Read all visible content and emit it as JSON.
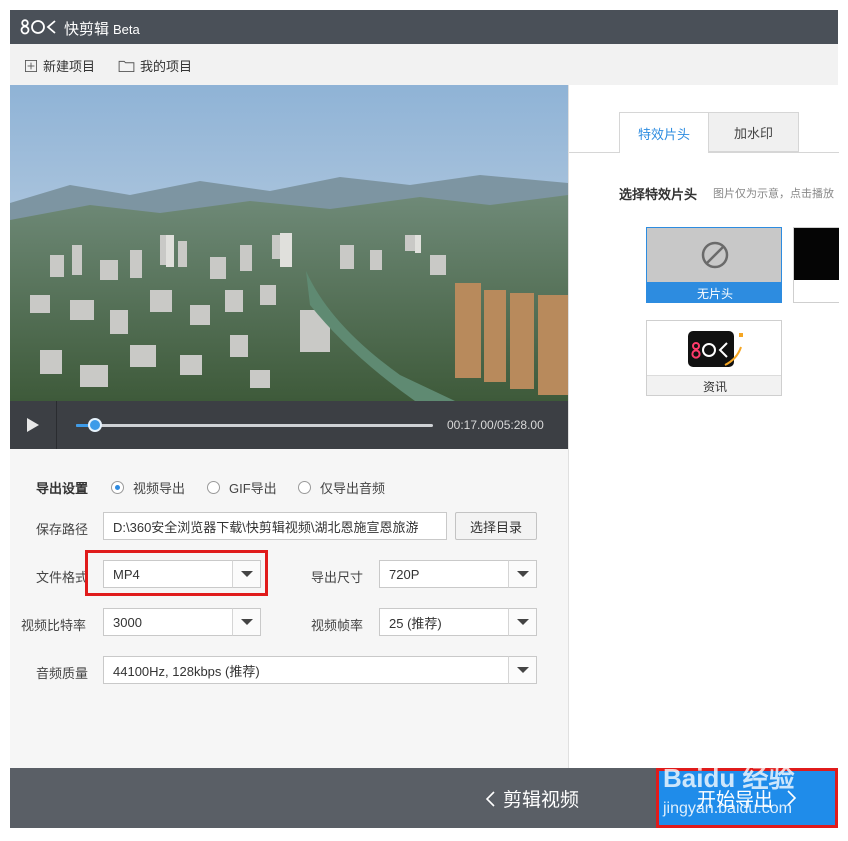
{
  "app": {
    "title": "快剪辑",
    "beta": "Beta"
  },
  "toolbar": {
    "new_project": "新建项目",
    "my_projects": "我的项目"
  },
  "player": {
    "time": "00:17.00/05:28.00",
    "progress": 0.054
  },
  "export": {
    "section_label": "导出设置",
    "modes": [
      "视频导出",
      "GIF导出",
      "仅导出音频"
    ],
    "selected_mode": 0,
    "save_path_label": "保存路径",
    "save_path_value": "D:\\360安全浏览器下载\\快剪辑视频\\湖北恩施宣恩旅游",
    "choose_dir_label": "选择目录",
    "format_label": "文件格式",
    "format_value": "MP4",
    "size_label": "导出尺寸",
    "size_value": "720P",
    "bitrate_label": "视频比特率",
    "bitrate_value": "3000",
    "framerate_label": "视频帧率",
    "framerate_value": "25 (推荐)",
    "audio_label": "音频质量",
    "audio_value": "44100Hz, 128kbps (推荐)"
  },
  "right_panel": {
    "tabs": [
      "特效片头",
      "加水印"
    ],
    "active_tab": 0,
    "section_title": "选择特效片头",
    "section_hint": "图片仅为示意，点击播放",
    "cards": [
      {
        "label": "无片头",
        "selected": true,
        "icon": "no-symbol-icon"
      },
      {
        "label": "资讯",
        "selected": false,
        "icon": "brand-logo-icon"
      }
    ]
  },
  "bottom": {
    "back_label": "剪辑视频",
    "export_label": "开始导出"
  },
  "watermark": {
    "brand": "Baidu 经验",
    "url": "jingyan.baidu.com"
  },
  "colors": {
    "accent": "#1f8cea",
    "highlight_box": "#e01b1b",
    "titlebar": "#4a5058",
    "bottom_bar": "#5a5f66"
  }
}
